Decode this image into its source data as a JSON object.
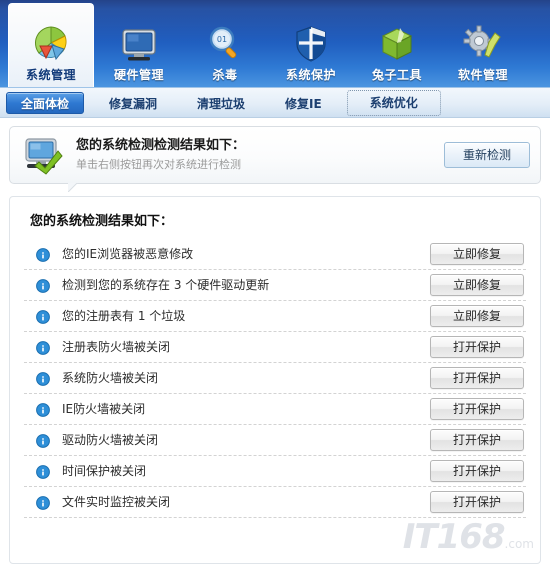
{
  "topnav": {
    "items": [
      {
        "label": "系统管理",
        "icon": "pie-chart-icon",
        "active": true
      },
      {
        "label": "硬件管理",
        "icon": "monitor-icon",
        "active": false
      },
      {
        "label": "杀毒",
        "icon": "magnifier-icon",
        "active": false
      },
      {
        "label": "系统保护",
        "icon": "shield-icon",
        "active": false
      },
      {
        "label": "兔子工具",
        "icon": "green-box-icon",
        "active": false
      },
      {
        "label": "软件管理",
        "icon": "gear-wrench-icon",
        "active": false
      }
    ]
  },
  "tabs": [
    {
      "label": "全面体检",
      "state": "active"
    },
    {
      "label": "修复漏洞",
      "state": "normal"
    },
    {
      "label": "清理垃圾",
      "state": "normal"
    },
    {
      "label": "修复IE",
      "state": "normal"
    },
    {
      "label": "系统优化",
      "state": "focused"
    }
  ],
  "summary": {
    "icon": "monitor-check-icon",
    "title": "您的系统检测检测结果如下：",
    "subtitle": "单击右侧按钮再次对系统进行检测",
    "rescan_label": "重新检测"
  },
  "results": {
    "heading": "您的系统检测结果如下：",
    "rows": [
      {
        "icon": "warning-icon",
        "label": "您的IE浏览器被恶意修改",
        "action": "立即修复"
      },
      {
        "icon": "warning-icon",
        "label": "检测到您的系统存在 3 个硬件驱动更新",
        "action": "立即修复"
      },
      {
        "icon": "warning-icon",
        "label": "您的注册表有 1 个垃圾",
        "action": "立即修复"
      },
      {
        "icon": "warning-icon",
        "label": "注册表防火墙被关闭",
        "action": "打开保护"
      },
      {
        "icon": "warning-icon",
        "label": "系统防火墙被关闭",
        "action": "打开保护"
      },
      {
        "icon": "warning-icon",
        "label": "IE防火墙被关闭",
        "action": "打开保护"
      },
      {
        "icon": "warning-icon",
        "label": "驱动防火墙被关闭",
        "action": "打开保护"
      },
      {
        "icon": "warning-icon",
        "label": "时间保护被关闭",
        "action": "打开保护"
      },
      {
        "icon": "warning-icon",
        "label": "文件实时监控被关闭",
        "action": "打开保护"
      }
    ]
  },
  "watermark": {
    "text": "IT168",
    "suffix": ".com"
  },
  "colors": {
    "nav_blue_dark": "#0b2e7c",
    "nav_blue_light": "#4b95e0",
    "tab_active": "#2f79d2",
    "warning_icon": "#2e8fd8",
    "divider": "#d3d3d3"
  }
}
